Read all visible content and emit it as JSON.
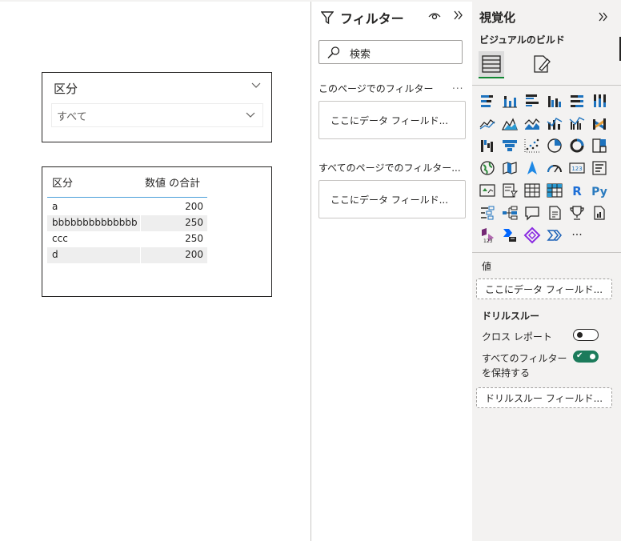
{
  "canvas": {
    "slicer": {
      "header": "区分",
      "selected": "すべて"
    },
    "table": {
      "columns": [
        "区分",
        "数値 の合計"
      ],
      "rows": [
        {
          "category": "a",
          "value": "200"
        },
        {
          "category": "bbbbbbbbbbbbbb",
          "value": "250"
        },
        {
          "category": "ccc",
          "value": "250"
        },
        {
          "category": "d",
          "value": "200"
        }
      ]
    }
  },
  "filter_pane": {
    "title": "フィルター",
    "search_placeholder": "検索",
    "page_section": "このページでのフィルター",
    "page_more": "...",
    "page_drop": "ここにデータ フィールド...",
    "all_pages_section": "すべてのページでのフィルター...",
    "all_pages_drop": "ここにデータ フィールド..."
  },
  "viz_pane": {
    "title": "視覚化",
    "subtitle": "ビジュアルのビルド",
    "values_label": "値",
    "values_drop": "ここにデータ フィールド...",
    "drillthrough_label": "ドリルスルー",
    "cross_report_label": "クロス レポート",
    "cross_report_on": false,
    "keep_filters_label_1": "すべてのフィルター",
    "keep_filters_label_2": "を保持する",
    "keep_filters_on": true,
    "drill_drop": "ドリルスルー フィールド...",
    "icons": [
      "stacked-bar-icon",
      "stacked-column-icon",
      "clustered-bar-icon",
      "clustered-column-icon",
      "100-bar-icon",
      "100-column-icon",
      "line-chart-icon",
      "area-chart-icon",
      "stacked-area-icon",
      "line-column-icon",
      "line-clustered-column-icon",
      "ribbon-chart-icon",
      "waterfall-icon",
      "funnel-icon",
      "scatter-icon",
      "pie-icon",
      "donut-icon",
      "treemap-icon",
      "map-icon",
      "filled-map-icon",
      "azure-map-icon",
      "gauge-icon",
      "card-icon",
      "multi-row-card-icon",
      "kpi-icon",
      "slicer-icon",
      "table-icon",
      "matrix-icon",
      "r-visual-icon",
      "python-visual-icon",
      "key-influencers-icon",
      "decomposition-tree-icon",
      "qna-icon",
      "smart-narrative-icon",
      "metrics-icon",
      "paginated-report-icon",
      "power-apps-icon",
      "power-automate-icon",
      "diamond-visual-icon",
      "chevron-visual-icon",
      "more-visuals-icon"
    ],
    "accent": "#118833",
    "toggle_on_color": "#1b7b5b",
    "r_label": "R",
    "py_label": "Py",
    "card_label": "123",
    "more_label": "···"
  }
}
